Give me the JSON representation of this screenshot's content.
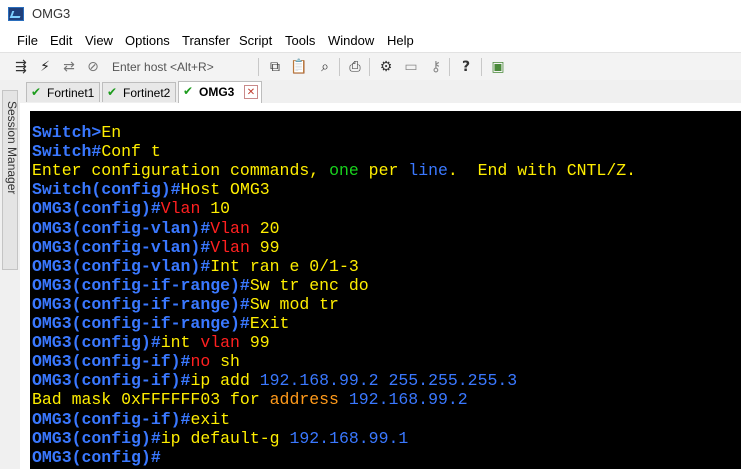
{
  "window": {
    "title": "OMG3"
  },
  "menu": [
    "File",
    "Edit",
    "View",
    "Options",
    "Transfer",
    "Script",
    "Tools",
    "Window",
    "Help"
  ],
  "toolbar": {
    "host_placeholder": "Enter host <Alt+R>"
  },
  "side_panel": {
    "label": "Session Manager"
  },
  "tabs": [
    {
      "label": "Fortinet1",
      "status": "connected"
    },
    {
      "label": "Fortinet2",
      "status": "connected"
    },
    {
      "label": "OMG3",
      "status": "connected",
      "active": true
    }
  ],
  "terminal": {
    "colors": {
      "prompt": "#3a78ff",
      "command": "#ffee00",
      "keyword": "#ff2020",
      "green": "#19d11e",
      "orange": "#ff9a1a",
      "background": "#000000"
    },
    "lines": [
      [
        {
          "t": "Switch>",
          "c": "prompt"
        },
        {
          "t": "En",
          "c": "cmd"
        }
      ],
      [
        {
          "t": "Switch#",
          "c": "prompt"
        },
        {
          "t": "Conf t",
          "c": "cmd"
        }
      ],
      [
        {
          "t": "Enter configuration commands, ",
          "c": "cmd"
        },
        {
          "t": "one",
          "c": "green"
        },
        {
          "t": " per ",
          "c": "cmd"
        },
        {
          "t": "line",
          "c": "ip"
        },
        {
          "t": ".  End with CNTL/Z.",
          "c": "cmd"
        }
      ],
      [
        {
          "t": "Switch(config)#",
          "c": "prompt"
        },
        {
          "t": "Host OMG3",
          "c": "cmd"
        }
      ],
      [
        {
          "t": "OMG3(config)#",
          "c": "prompt"
        },
        {
          "t": "Vlan",
          "c": "vlan"
        },
        {
          "t": " 10",
          "c": "cmd"
        }
      ],
      [
        {
          "t": "OMG3(config-vlan)#",
          "c": "prompt"
        },
        {
          "t": "Vlan",
          "c": "vlan"
        },
        {
          "t": " 20",
          "c": "cmd"
        }
      ],
      [
        {
          "t": "OMG3(config-vlan)#",
          "c": "prompt"
        },
        {
          "t": "Vlan",
          "c": "vlan"
        },
        {
          "t": " 99",
          "c": "cmd"
        }
      ],
      [
        {
          "t": "OMG3(config-vlan)#",
          "c": "prompt"
        },
        {
          "t": "Int ran e 0/1-3",
          "c": "cmd"
        }
      ],
      [
        {
          "t": "OMG3(config-if-range)#",
          "c": "prompt"
        },
        {
          "t": "Sw tr enc do",
          "c": "cmd"
        }
      ],
      [
        {
          "t": "OMG3(config-if-range)#",
          "c": "prompt"
        },
        {
          "t": "Sw mod tr",
          "c": "cmd"
        }
      ],
      [
        {
          "t": "OMG3(config-if-range)#",
          "c": "prompt"
        },
        {
          "t": "Exit",
          "c": "cmd"
        }
      ],
      [
        {
          "t": "OMG3(config)#",
          "c": "prompt"
        },
        {
          "t": "int ",
          "c": "cmd"
        },
        {
          "t": "vlan",
          "c": "vlan"
        },
        {
          "t": " 99",
          "c": "cmd"
        }
      ],
      [
        {
          "t": "OMG3(config-if)#",
          "c": "prompt"
        },
        {
          "t": "no",
          "c": "vlan"
        },
        {
          "t": " sh",
          "c": "cmd"
        }
      ],
      [
        {
          "t": "OMG3(config-if)#",
          "c": "prompt"
        },
        {
          "t": "ip add ",
          "c": "cmd"
        },
        {
          "t": "192.168.99.2 255.255.255.3",
          "c": "ip"
        }
      ],
      [
        {
          "t": "Bad mask 0xFFFFFF03 for ",
          "c": "cmd"
        },
        {
          "t": "address",
          "c": "orange"
        },
        {
          "t": " ",
          "c": "cmd"
        },
        {
          "t": "192.168.99.2",
          "c": "ip"
        }
      ],
      [
        {
          "t": "OMG3(config-if)#",
          "c": "prompt"
        },
        {
          "t": "exit",
          "c": "cmd"
        }
      ],
      [
        {
          "t": "OMG3(config)#",
          "c": "prompt"
        },
        {
          "t": "ip default-g ",
          "c": "cmd"
        },
        {
          "t": "192.168.99.1",
          "c": "ip"
        }
      ],
      [
        {
          "t": "OMG3(config)#",
          "c": "prompt"
        }
      ]
    ]
  }
}
